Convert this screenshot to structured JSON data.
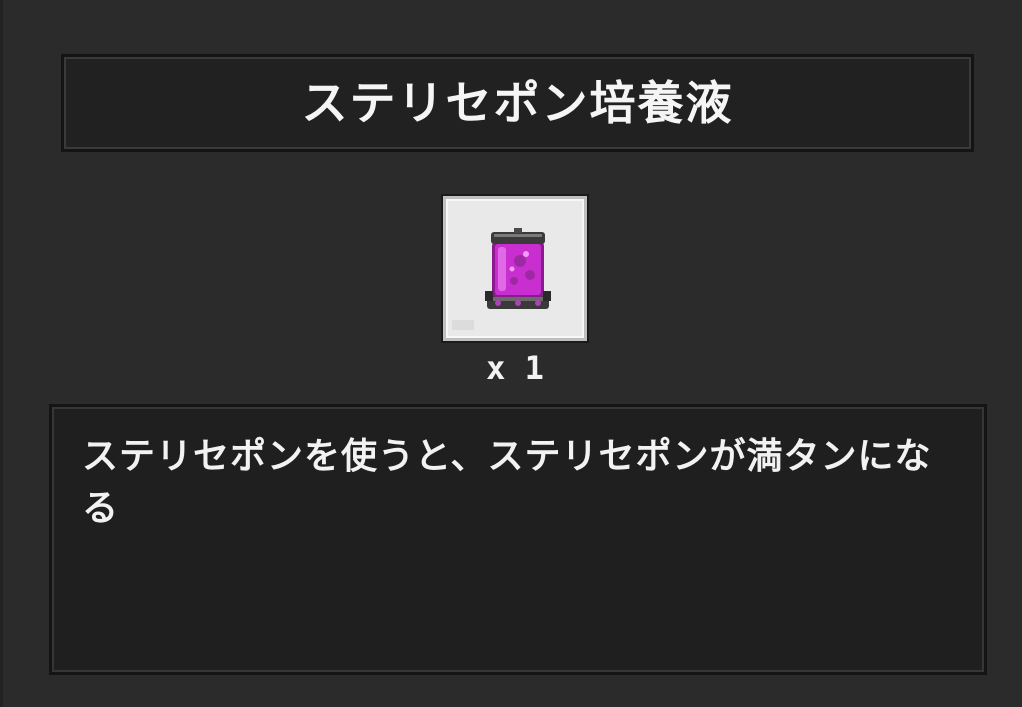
{
  "item": {
    "name": "ステリセポン培養液",
    "quantity": "x 1",
    "description": "ステリセポンを使うと、ステリセポンが満タンになる",
    "icon": "magenta-culture-canister-icon"
  },
  "colors": {
    "background": "#2b2b2b",
    "panel": "#212121",
    "slot": "#e9e9e9",
    "liquid": "#d43ad8"
  }
}
